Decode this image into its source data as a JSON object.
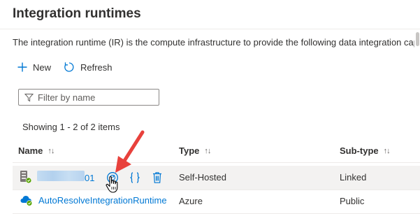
{
  "page": {
    "title": "Integration runtimes",
    "description": "The integration runtime (IR) is the compute infrastructure to provide the following data integration cap"
  },
  "toolbar": {
    "new_label": "New",
    "refresh_label": "Refresh"
  },
  "filter": {
    "placeholder": "Filter by name",
    "value": ""
  },
  "list": {
    "count_text": "Showing 1 - 2 of 2 items"
  },
  "table": {
    "columns": [
      {
        "label": "Name",
        "sort_icon": "↑↓"
      },
      {
        "label": "Type",
        "sort_icon": "↑↓"
      },
      {
        "label": "Sub-type",
        "sort_icon": "↑↓"
      }
    ],
    "rows": [
      {
        "name_suffix": "01",
        "type": "Self-Hosted",
        "subtype": "Linked",
        "icon": "server-icon",
        "selected": true
      },
      {
        "name": "AutoResolveIntegrationRuntime",
        "type": "Azure",
        "subtype": "Public",
        "icon": "cloud-icon",
        "selected": false
      }
    ]
  },
  "colors": {
    "accent": "#0078d4",
    "annotation_arrow": "#e8413c",
    "selected_row": "#f3f2f1",
    "text": "#323130"
  },
  "icons": [
    "plus-icon",
    "refresh-icon",
    "filter-icon",
    "server-icon",
    "cloud-icon",
    "monitor-icon",
    "code-icon",
    "delete-icon",
    "hand-cursor-icon",
    "annotation-arrow"
  ]
}
